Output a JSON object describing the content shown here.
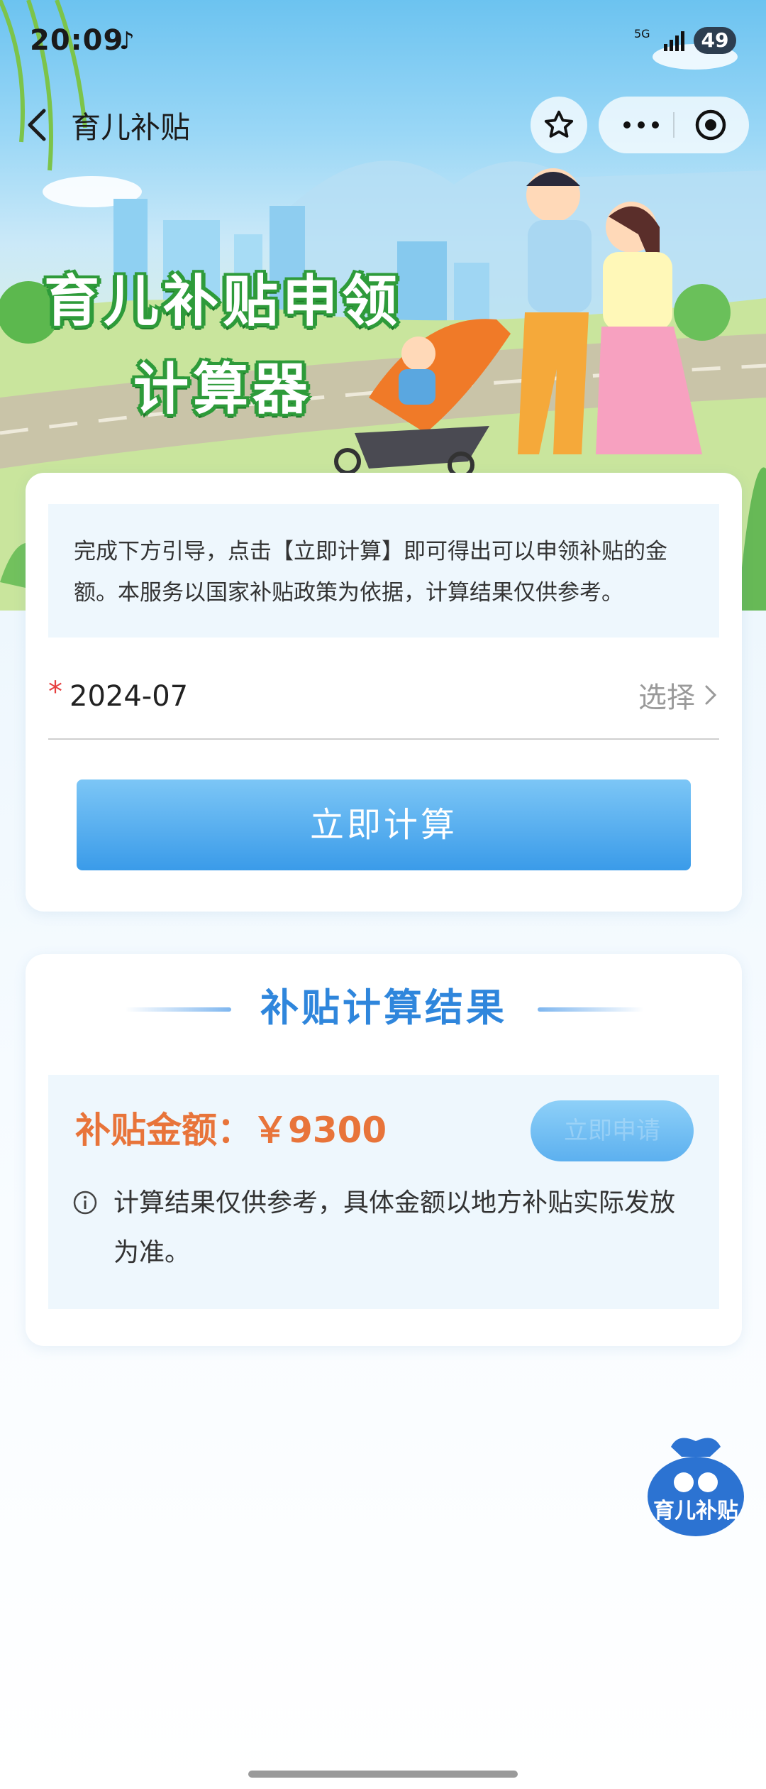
{
  "status_bar": {
    "time": "20:09",
    "network": "5G",
    "battery": "49"
  },
  "nav": {
    "title": "育儿补贴"
  },
  "hero": {
    "title_line1": "育儿补贴申领",
    "title_line2": "计算器"
  },
  "form": {
    "intro": "完成下方引导，点击【立即计算】即可得出可以申领补贴的金额。本服务以国家补贴政策为依据，计算结果仅供参考。",
    "required_mark": "*",
    "date_value": "2024-07",
    "select_label": "选择",
    "calculate_button": "立即计算"
  },
  "result": {
    "heading": "补贴计算结果",
    "amount_label": "补贴金额：￥9300",
    "ghost_button": "立即申请",
    "note": "计算结果仅供参考，具体金额以地方补贴实际发放为准。"
  },
  "fab": {
    "label": "育儿补贴"
  }
}
